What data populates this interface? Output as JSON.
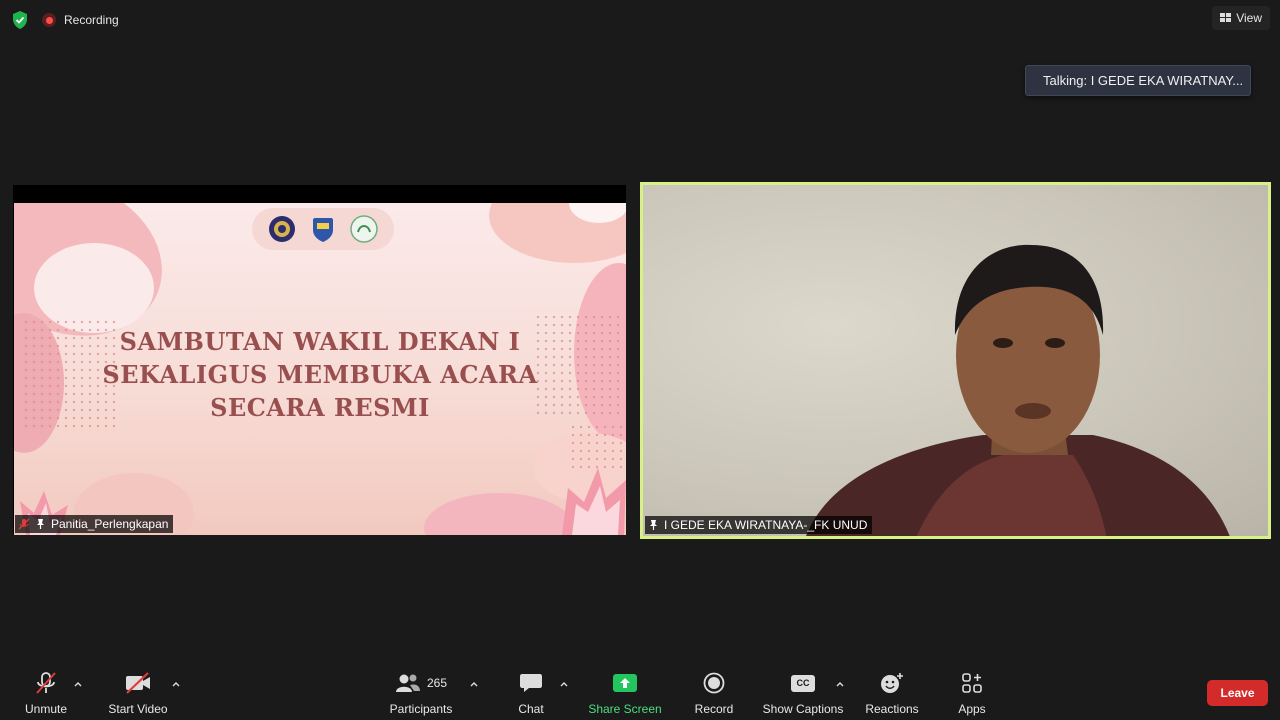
{
  "topbar": {
    "recording_label": "Recording",
    "view_label": "View"
  },
  "talking_indicator": "Talking: I GEDE EKA WIRATNAY...",
  "share_tile": {
    "participant_name": "Panitia_Perlengkapan",
    "slide_lines": [
      "SAMBUTAN WAKIL DEKAN I",
      "SEKALIGUS MEMBUKA ACARA",
      "SECARA RESMI"
    ]
  },
  "video_tile": {
    "participant_name": "I GEDE EKA WIRATNAYA-_FK UNUD",
    "highlight_color": "#d7f08a"
  },
  "toolbar": {
    "unmute": "Unmute",
    "start_video": "Start Video",
    "participants": "Participants",
    "participants_count": "265",
    "chat": "Chat",
    "share_screen": "Share Screen",
    "record": "Record",
    "show_captions": "Show Captions",
    "cc_glyph": "CC",
    "reactions": "Reactions",
    "apps": "Apps",
    "leave": "Leave"
  },
  "colors": {
    "background": "#1a1a1a",
    "share_green": "#22c55e",
    "leave_red": "#d32a2a",
    "mute_red": "#e03b3b"
  }
}
